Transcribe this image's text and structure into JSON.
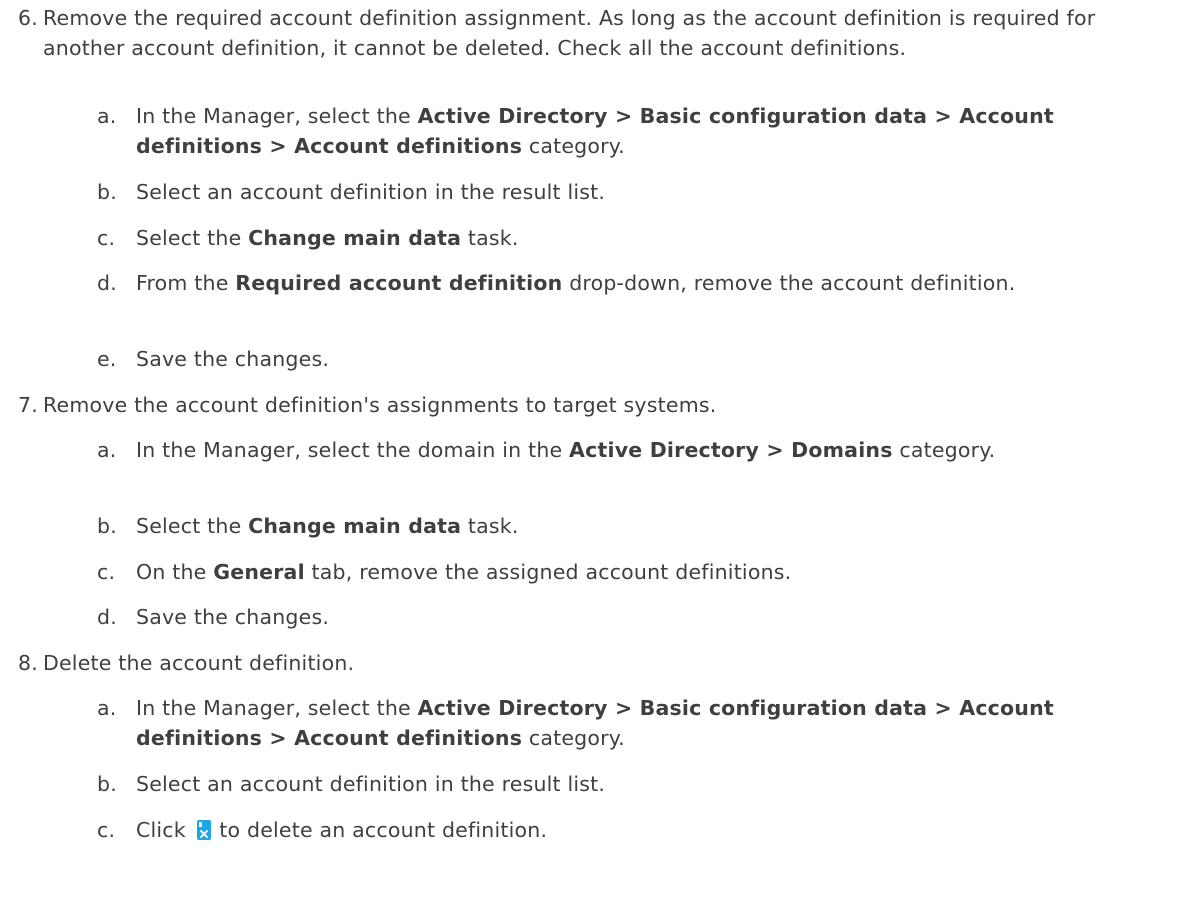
{
  "steps": [
    {
      "num": "6.",
      "text": "Remove the required account definition assignment. As long as the account definition is required for another account definition, it cannot be deleted. Check all the account definitions.",
      "substeps": [
        {
          "letter": "a.",
          "pre": "In the Manager, select the ",
          "bold": "Active Directory > Basic configuration data > Account definitions > Account definitions",
          "post": " category."
        },
        {
          "letter": "b.",
          "text": "Select an account definition in the result list."
        },
        {
          "letter": "c.",
          "pre": "Select the ",
          "bold": "Change main data",
          "post": " task."
        },
        {
          "letter": "d.",
          "pre": "From the ",
          "bold": "Required account definition",
          "post": " drop-down, remove the account definition."
        },
        {
          "letter": "e.",
          "text": "Save the changes."
        }
      ]
    },
    {
      "num": "7.",
      "text": "Remove the account definition's assignments to target systems.",
      "substeps": [
        {
          "letter": "a.",
          "pre": "In the Manager, select the domain in the ",
          "bold": "Active Directory > Domains",
          "post": " category."
        },
        {
          "letter": "b.",
          "pre": "Select the ",
          "bold": "Change main data",
          "post": " task."
        },
        {
          "letter": "c.",
          "pre": "On the ",
          "bold": "General",
          "post": " tab, remove the assigned account definitions."
        },
        {
          "letter": "d.",
          "text": "Save the changes."
        }
      ]
    },
    {
      "num": "8.",
      "text": "Delete the account definition.",
      "substeps": [
        {
          "letter": "a.",
          "pre": "In the Manager, select the ",
          "bold": "Active Directory > Basic configuration data > Account definitions > Account definitions",
          "post": " category."
        },
        {
          "letter": "b.",
          "text": "Select an account definition in the result list."
        },
        {
          "letter": "c.",
          "pre": "Click ",
          "icon": "delete-icon",
          "post": " to delete an account definition."
        }
      ]
    }
  ],
  "colors": {
    "text": "#3f3f3f",
    "icon_primary": "#1ea7e0",
    "icon_accent": "#f2f2f2"
  }
}
